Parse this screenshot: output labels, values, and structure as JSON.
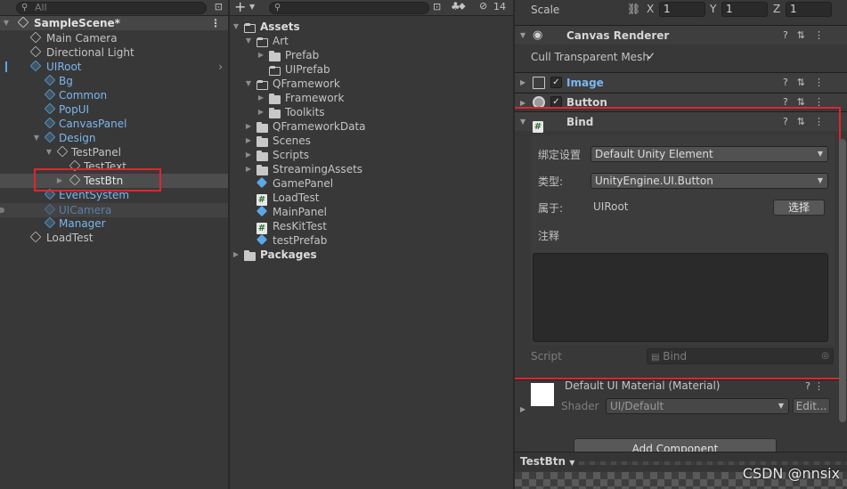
{
  "hierarchy": {
    "search_placeholder": "All",
    "scene_name": "SampleScene*",
    "items": [
      {
        "label": "Main Camera"
      },
      {
        "label": "Directional Light"
      },
      {
        "label": "UIRoot"
      },
      {
        "label": "Bg"
      },
      {
        "label": "Common"
      },
      {
        "label": "PopUI"
      },
      {
        "label": "CanvasPanel"
      },
      {
        "label": "Design"
      },
      {
        "label": "TestPanel"
      },
      {
        "label": "TestText"
      },
      {
        "label": "TestBtn"
      },
      {
        "label": "EventSystem"
      },
      {
        "label": "UICamera"
      },
      {
        "label": "Manager"
      },
      {
        "label": "LoadTest"
      }
    ]
  },
  "project": {
    "add_label": "+",
    "hidden_count": "14",
    "items": [
      {
        "label": "Assets"
      },
      {
        "label": "Art"
      },
      {
        "label": "Prefab"
      },
      {
        "label": "UIPrefab"
      },
      {
        "label": "QFramework"
      },
      {
        "label": "Framework"
      },
      {
        "label": "Toolkits"
      },
      {
        "label": "QFrameworkData"
      },
      {
        "label": "Scenes"
      },
      {
        "label": "Scripts"
      },
      {
        "label": "StreamingAssets"
      },
      {
        "label": "GamePanel"
      },
      {
        "label": "LoadTest"
      },
      {
        "label": "MainPanel"
      },
      {
        "label": "ResKitTest"
      },
      {
        "label": "testPrefab"
      },
      {
        "label": "Packages"
      }
    ]
  },
  "inspector": {
    "scale_label": "Scale",
    "scale": {
      "x_label": "X",
      "x": "1",
      "y_label": "Y",
      "y": "1",
      "z_label": "Z",
      "z": "1"
    },
    "canvas_renderer": {
      "title": "Canvas Renderer",
      "cull_label": "Cull Transparent Mesh"
    },
    "image": {
      "title": "Image"
    },
    "button": {
      "title": "Button"
    },
    "bind": {
      "title": "Bind",
      "setting_label": "绑定设置",
      "setting_value": "Default Unity Element",
      "type_label": "类型:",
      "type_value": "UnityEngine.UI.Button",
      "belongs_label": "属于:",
      "belongs_value": "UIRoot",
      "select_button": "选择",
      "comment_label": "注释",
      "script_label": "Script",
      "script_value": "Bind"
    },
    "material": {
      "title": "Default UI Material (Material)",
      "shader_label": "Shader",
      "shader_value": "UI/Default",
      "edit_button": "Edit..."
    },
    "add_component": "Add Component",
    "bottom_tab": "TestBtn"
  },
  "watermark": "CSDN @nnsix",
  "colors": {
    "accent_blue": "#5aa8e6",
    "highlight_red": "#e0252f",
    "panel_bg": "#383838"
  }
}
